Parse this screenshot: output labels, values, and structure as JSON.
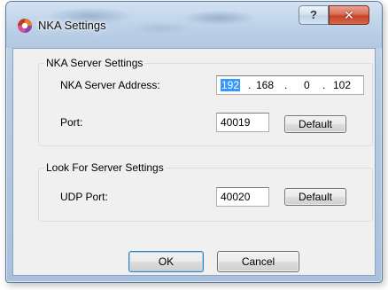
{
  "window": {
    "title": "NKA Settings",
    "help_glyph": "?",
    "close_glyph": "✕",
    "app_icon": "nka-app-icon"
  },
  "server_settings": {
    "group_label": "NKA Server Settings",
    "address_label": "NKA Server Address:",
    "ip": {
      "octet1": "192",
      "octet2": "168",
      "octet3": "0",
      "octet4": "102",
      "dot": "."
    },
    "port_label": "Port:",
    "port_value": "40019",
    "default_label": "Default"
  },
  "lookup_settings": {
    "group_label": "Look For Server Settings",
    "udp_label": "UDP Port:",
    "udp_value": "40020",
    "default_label": "Default"
  },
  "actions": {
    "ok_label": "OK",
    "cancel_label": "Cancel"
  }
}
